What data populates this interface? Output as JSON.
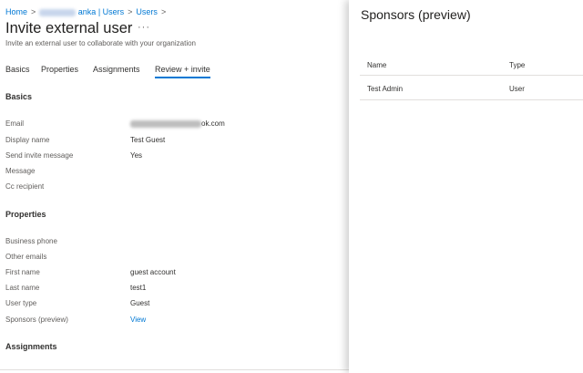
{
  "breadcrumb": {
    "home": "Home",
    "tenant_suffix": "anka | Users",
    "users": "Users"
  },
  "page": {
    "title": "Invite external user",
    "more": "···",
    "subtitle": "Invite an external user to collaborate with your organization"
  },
  "tabs": [
    "Basics",
    "Properties",
    "Assignments",
    "Review + invite"
  ],
  "basics": {
    "heading": "Basics",
    "fields": [
      {
        "label": "Email",
        "value": "ok.com"
      },
      {
        "label": "Display name",
        "value": "Test Guest"
      },
      {
        "label": "Send invite message",
        "value": "Yes"
      },
      {
        "label": "Message",
        "value": ""
      },
      {
        "label": "Cc recipient",
        "value": ""
      }
    ]
  },
  "properties": {
    "heading": "Properties",
    "fields": [
      {
        "label": "Business phone",
        "value": ""
      },
      {
        "label": "Other emails",
        "value": ""
      },
      {
        "label": "First name",
        "value": "guest account"
      },
      {
        "label": "Last name",
        "value": "test1"
      },
      {
        "label": "User type",
        "value": "Guest"
      },
      {
        "label": "Sponsors (preview)",
        "value": "View"
      }
    ]
  },
  "assignments": {
    "heading": "Assignments"
  },
  "sponsors_panel": {
    "title": "Sponsors (preview)",
    "columns": [
      "Name",
      "Type"
    ],
    "rows": [
      {
        "name": "Test Admin",
        "type": "User"
      }
    ]
  },
  "colors": {
    "accent": "#0078d4",
    "text": "#323130",
    "muted": "#605e5c"
  }
}
